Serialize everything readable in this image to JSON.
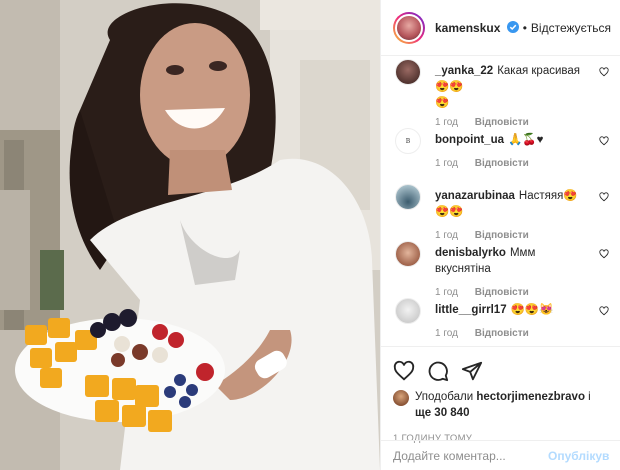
{
  "post": {
    "image_alt": "Woman holding a plate of fruit",
    "header": {
      "username": "kamenskux",
      "dot": "•",
      "follow_status": "Відстежується"
    },
    "comments": [
      {
        "username": "_yanka_22",
        "text": "Какая красивая😍😍\n😍",
        "time": "1 год",
        "reply": "Відповісти",
        "avatar_color": "#6b4a44"
      },
      {
        "username": "bonpoint_ua",
        "text": "🙏🍒♥",
        "time": "1 год",
        "reply": "Відповісти",
        "avatar_color": "#ffffff"
      },
      {
        "username": "yanazarubinaa",
        "text": "Настяяя😍😍😍",
        "time": "1 год",
        "reply": "Відповісти",
        "avatar_color": "#3b5a6b"
      },
      {
        "username": "denisbalyrko",
        "text": "Ммм вкуснятіна",
        "time": "1 год",
        "reply": "Відповісти",
        "avatar_color": "#c8836a"
      },
      {
        "username": "little__girrl17",
        "text": "😍😍😻",
        "time": "1 год",
        "reply": "Відповісти",
        "avatar_color": "#d8d8d8"
      }
    ],
    "likes": {
      "prefix": "Уподобали ",
      "user": "hectorjimenezbravo",
      "suffix": " і",
      "more_prefix": "ще ",
      "count": "30 840"
    },
    "timestamp": "1 ГОДИНУ ТОМУ",
    "add_comment": {
      "placeholder": "Додайте коментар...",
      "publish_label": "Опублікув"
    }
  },
  "colors": {
    "link_blue": "#0095f6",
    "muted_text": "#8e8e8e",
    "border": "#efefef",
    "publish_disabled": "#b3dbff"
  }
}
